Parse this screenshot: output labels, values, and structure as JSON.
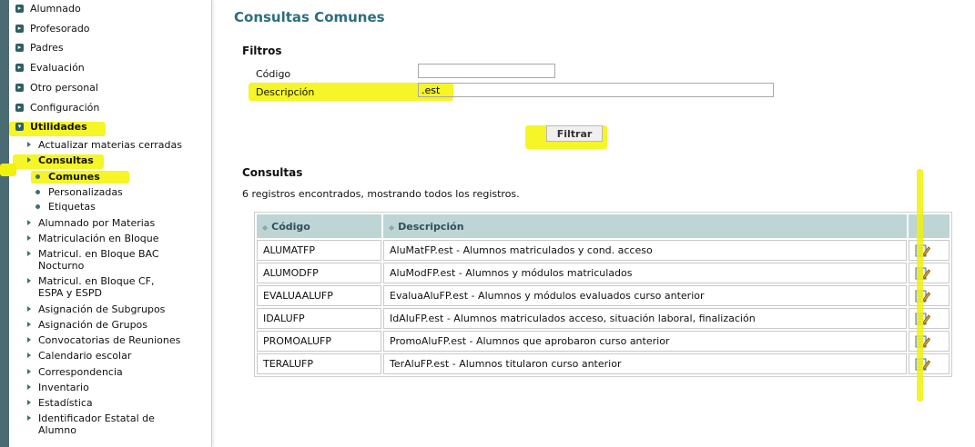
{
  "sidebar": {
    "items": [
      {
        "label": "Alumnado"
      },
      {
        "label": "Profesorado"
      },
      {
        "label": "Padres"
      },
      {
        "label": "Evaluación"
      },
      {
        "label": "Otro personal"
      },
      {
        "label": "Configuración"
      },
      {
        "label": "Utilidades"
      }
    ],
    "sub": [
      {
        "label": "Actualizar materias cerradas"
      },
      {
        "label": "Consultas"
      },
      {
        "label": "Alumnado por Materias"
      },
      {
        "label": "Matriculación en Bloque"
      },
      {
        "label": "Matricul. en Bloque BAC\nNocturno"
      },
      {
        "label": "Matricul. en Bloque CF,\nESPA y ESPD"
      },
      {
        "label": "Asignación de Subgrupos"
      },
      {
        "label": "Asignación de Grupos"
      },
      {
        "label": "Convocatorias de Reuniones"
      },
      {
        "label": "Calendario escolar"
      },
      {
        "label": "Correspondencia"
      },
      {
        "label": "Inventario"
      },
      {
        "label": "Estadística"
      },
      {
        "label": "Identificador Estatal de\nAlumno"
      }
    ],
    "consultas_children": [
      {
        "label": "Comunes"
      },
      {
        "label": "Personalizadas"
      },
      {
        "label": "Etiquetas"
      }
    ]
  },
  "main": {
    "title": "Consultas Comunes",
    "filters": {
      "heading": "Filtros",
      "codigo_label": "Código",
      "codigo_value": "",
      "descripcion_label": "Descripción",
      "descripcion_value": ".est",
      "button": "Filtrar"
    },
    "results": {
      "heading": "Consultas",
      "count_text": "6 registros encontrados, mostrando todos los registros.",
      "columns": [
        "Código",
        "Descripción"
      ],
      "rows": [
        {
          "code": "ALUMATFP",
          "desc": "AluMatFP.est - Alumnos matriculados y cond. acceso"
        },
        {
          "code": "ALUMODFP",
          "desc": "AluModFP.est - Alumnos y módulos matriculados"
        },
        {
          "code": "EVALUAALUFP",
          "desc": "EvaluaAluFP.est - Alumnos y módulos evaluados curso anterior"
        },
        {
          "code": "IDALUFP",
          "desc": "IdAluFP.est - Alumnos matriculados acceso, situación laboral, finalización"
        },
        {
          "code": "PROMOALUFP",
          "desc": "PromoAluFP.est - Alumnos que aprobaron curso anterior"
        },
        {
          "code": "TERALUFP",
          "desc": "TerAluFP.est - Alumnos titularon curso anterior"
        }
      ]
    }
  },
  "colors": {
    "accent": "#2e6e7e",
    "header_bg": "#bdd5d5",
    "highlight": "#f4f410"
  }
}
